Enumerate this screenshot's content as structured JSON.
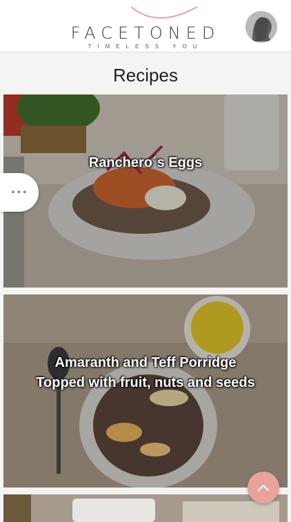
{
  "header": {
    "brand_name": "FACETONED",
    "brand_tagline": "TIMELESS YOU"
  },
  "page": {
    "title": "Recipes"
  },
  "recipes": [
    {
      "title_line1": "Ranchero´s Eggs",
      "title_line2": ""
    },
    {
      "title_line1": "Amaranth and Teff Porridge",
      "title_line2": "Topped with fruit, nuts and seeds"
    }
  ],
  "more_button": {
    "label": "···"
  },
  "icons": {
    "avatar": "avatar-silhouette-icon",
    "more": "more-dots-icon",
    "scroll_top": "chevron-up-icon"
  },
  "colors": {
    "accent": "#e9a39a",
    "header_bg": "#ffffff",
    "page_bg": "#f4f4f4"
  }
}
